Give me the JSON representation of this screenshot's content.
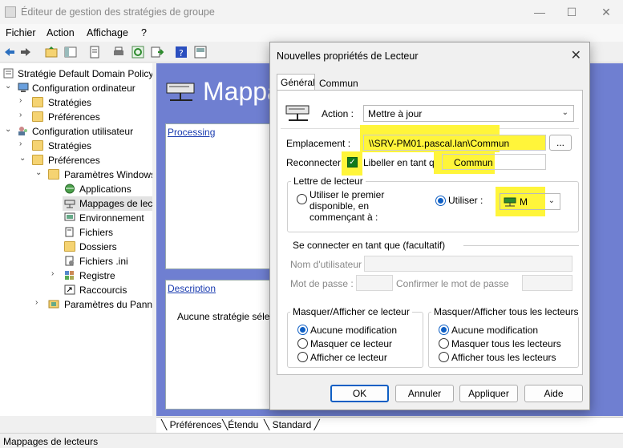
{
  "window": {
    "title": "Éditeur de gestion des stratégies de groupe",
    "controls": {
      "minimize": "—",
      "maximize": "☐",
      "close": "✕"
    }
  },
  "menu": [
    "Fichier",
    "Action",
    "Affichage",
    "?"
  ],
  "tree": {
    "root": "Stratégie Default Domain Policy",
    "items": [
      "Configuration ordinateur",
      "Stratégies",
      "Préférences",
      "Configuration utilisateur",
      "Stratégies",
      "Préférences",
      "Paramètres Windows",
      "Applications",
      "Mappages de lecteurs",
      "Environnement",
      "Fichiers",
      "Dossiers",
      "Fichiers .ini",
      "Registre",
      "Raccourcis",
      "Paramètres du Panneau de configuration"
    ]
  },
  "right_pane": {
    "title": "Mappages de lecteurs",
    "processing_link": "Processing",
    "description_link": "Description",
    "description_text": "Aucune stratégie sélectionnée"
  },
  "bottom_tabs": [
    "Préférences",
    "Étendu",
    "Standard"
  ],
  "status": "Mappages de lecteurs",
  "dialog": {
    "title": "Nouvelles propriétés de Lecteur",
    "close": "✕",
    "tabs": [
      "Général",
      "Commun"
    ],
    "action_label": "Action :",
    "action_value": "Mettre à jour",
    "location_label": "Emplacement :",
    "location_value": "\\\\SRV-PM01.pascal.lan\\Commun",
    "browse_label": "...",
    "reconnect_label": "Reconnecter :",
    "label_as_label": "Libeller en tant que :",
    "label_as_value": "Commun",
    "drive_letter_group": "Lettre de lecteur",
    "use_first_label": "Utiliser le premier disponible, en commençant à :",
    "use_label": "Utiliser :",
    "drive_value": "M",
    "connect_as_group": "Se connecter en tant que (facultatif)",
    "username_label": "Nom d'utilisateur :",
    "password_label": "Mot de passe :",
    "confirm_password_label": "Confirmer le mot de passe",
    "hide_show_drive_group": "Masquer/Afficher ce lecteur",
    "hide_show_drive_options": [
      "Aucune modification",
      "Masquer ce lecteur",
      "Afficher ce lecteur"
    ],
    "hide_show_all_group": "Masquer/Afficher tous les lecteurs",
    "hide_show_all_options": [
      "Aucune modification",
      "Masquer tous les lecteurs",
      "Afficher tous les lecteurs"
    ],
    "buttons": {
      "ok": "OK",
      "cancel": "Annuler",
      "apply": "Appliquer",
      "help": "Aide"
    }
  },
  "colors": {
    "pane_bg": "#6f7fd1",
    "highlight": "#fff53a",
    "accent": "#0f5fc4"
  }
}
